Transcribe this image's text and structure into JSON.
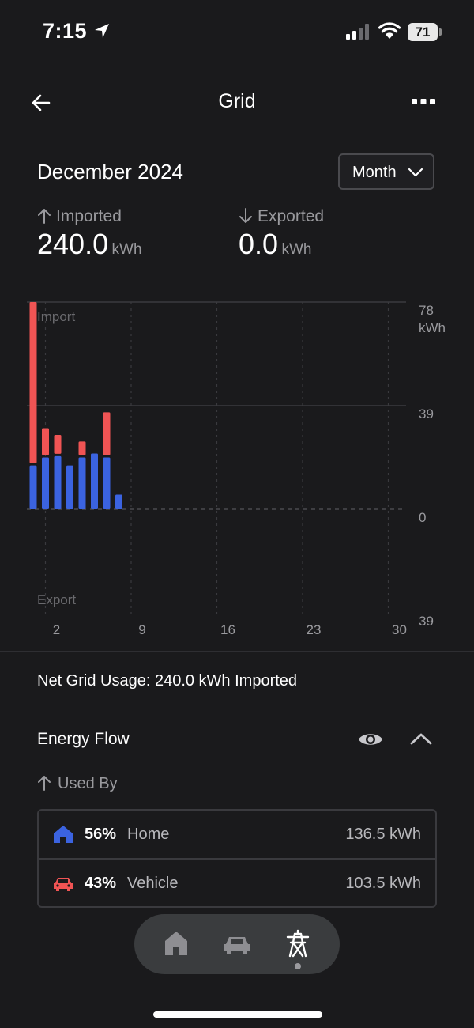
{
  "status_bar": {
    "time": "7:15",
    "battery": "71"
  },
  "header": {
    "title": "Grid"
  },
  "period": {
    "label": "December 2024",
    "selector": "Month"
  },
  "stats": {
    "imported": {
      "label": "Imported",
      "value": "240.0",
      "unit": "kWh"
    },
    "exported": {
      "label": "Exported",
      "value": "0.0",
      "unit": "kWh"
    }
  },
  "chart_data": {
    "type": "bar",
    "stacked": true,
    "import_label": "Import",
    "export_label": "Export",
    "x_ticks": [
      "2",
      "9",
      "16",
      "23",
      "30"
    ],
    "y_ticks": [
      "78",
      "39",
      "0",
      "39"
    ],
    "y_unit": "kWh",
    "ylim": [
      -39,
      78
    ],
    "days": [
      1,
      2,
      3,
      4,
      5,
      6,
      7,
      8
    ],
    "series": [
      {
        "color": "#3b63e0",
        "values": [
          16.5,
          19.5,
          20,
          16.5,
          19.5,
          21,
          19.5,
          5.5
        ]
      },
      {
        "color": "#f05454",
        "values": [
          61.5,
          11,
          8,
          0,
          6,
          0,
          17,
          0
        ]
      }
    ]
  },
  "net_usage": "Net Grid Usage: 240.0 kWh Imported",
  "energy_flow": {
    "title": "Energy Flow",
    "used_by_label": "Used By",
    "rows": [
      {
        "icon": "house-icon",
        "percent": "56%",
        "name": "Home",
        "value": "136.5 kWh",
        "color": "#3b63e0"
      },
      {
        "icon": "car-icon",
        "percent": "43%",
        "name": "Vehicle",
        "value": "103.5 kWh",
        "color": "#f05454"
      }
    ]
  },
  "nav": {
    "items": [
      "home",
      "vehicle",
      "grid"
    ],
    "active": "grid"
  }
}
